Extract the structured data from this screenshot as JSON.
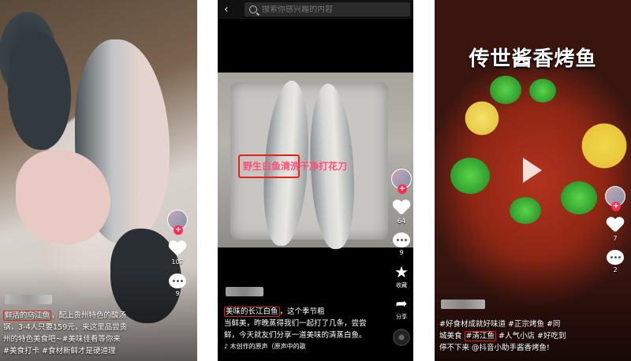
{
  "post1": {
    "caption_highlight": "鲜活的乌江鱼",
    "caption_rest_line1": "，配上贵州特色的酸汤",
    "caption_line2": "锅，3-4人只要159元，来这里品尝贵",
    "caption_line3": "州的特色美食吧~#美味佳肴等你来",
    "caption_line4": "#美食打卡 #食材新鲜才是硬道理",
    "likes": "107",
    "comments": "9"
  },
  "post2": {
    "search_placeholder": "搜索你感兴趣的内容",
    "overlay_boxed": "野生白鱼",
    "overlay_rest": "清洗干净打花刀",
    "caption_prefix": "",
    "caption_boxed": "美味的长江白鱼",
    "caption_line1_rest": "，这个季节粗",
    "caption_line2": "当鲜美，昨晚蒸得我们一起打了几条，尝尝",
    "caption_line3": "鲜，今天就友们分享一道美味的清蒸白鱼。",
    "music": "♪ 木创作的原声（原声中的歌",
    "likes": "64",
    "comments": "9",
    "favorites_label": "收藏",
    "share_label": "分享"
  },
  "post3": {
    "title": "传世酱香烤鱼",
    "caption_line1": "#好食材成就好味道 #正宗烤鱼 #同",
    "caption_line2": "城美食 ",
    "caption_boxed": "#清江鱼",
    "caption_line2_rest": " #人气小店 #好吃到",
    "caption_line3": "停不下来 @抖音小助手酱香烤鱼!",
    "likes": "7",
    "comments": "2"
  }
}
